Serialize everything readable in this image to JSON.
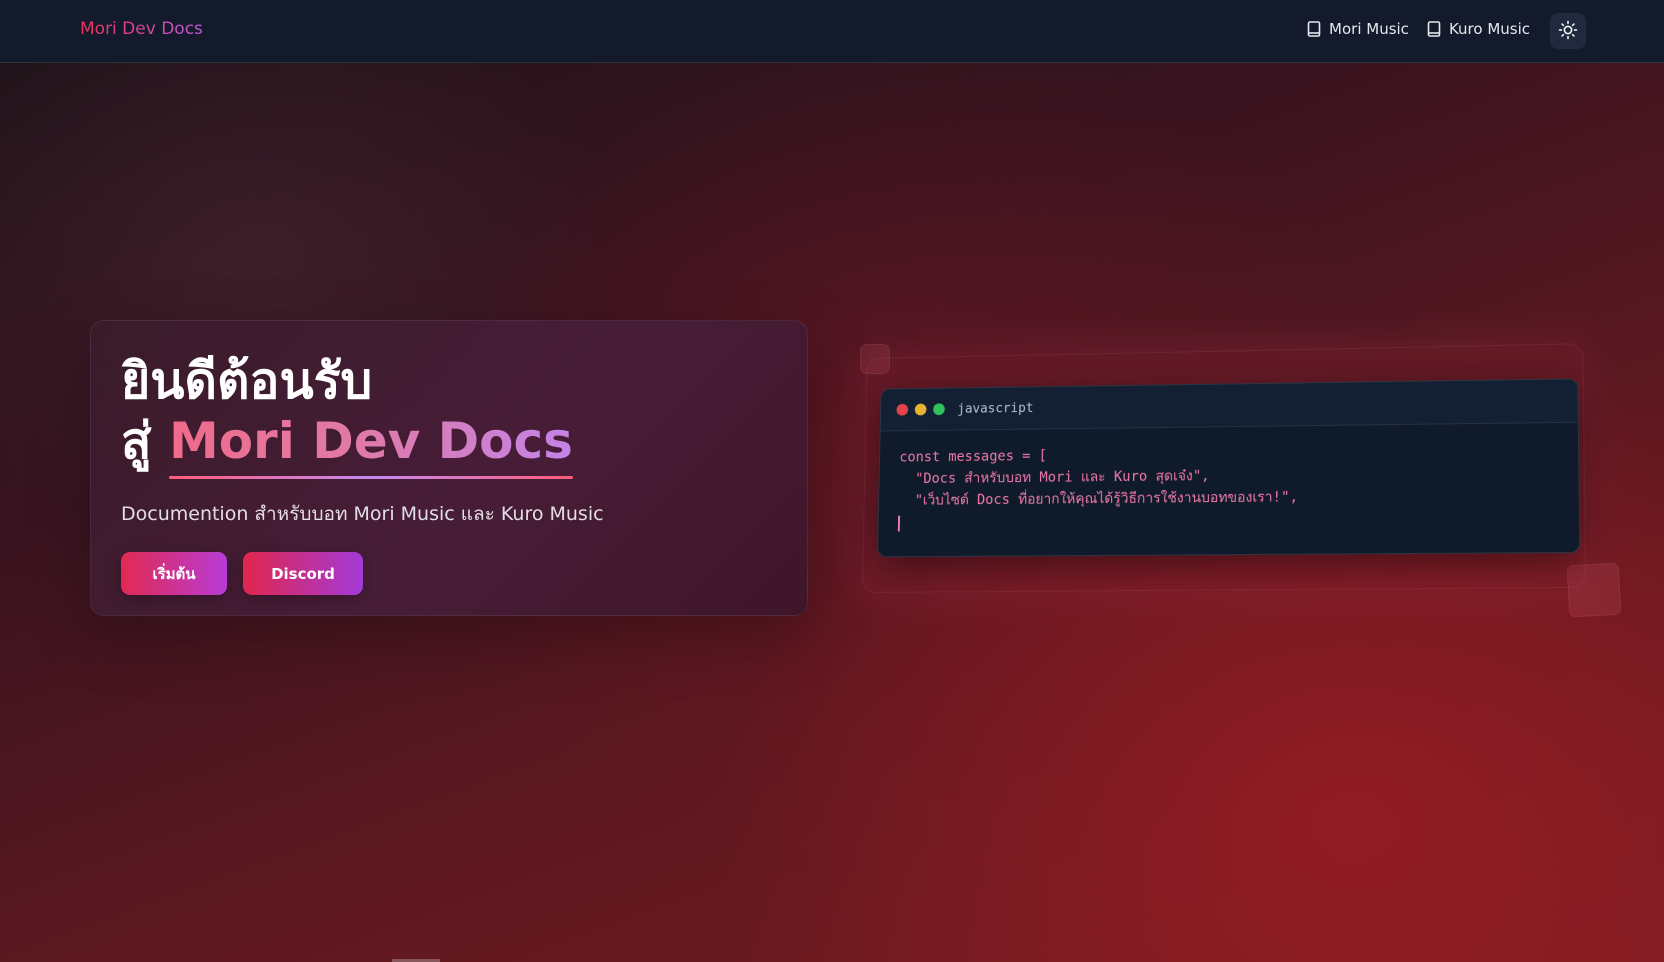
{
  "header": {
    "brand": "Mori Dev Docs",
    "nav_links": [
      {
        "label": "Mori Music",
        "icon": "book-icon"
      },
      {
        "label": "Kuro Music",
        "icon": "book-icon"
      }
    ],
    "theme_toggle_icon": "sun-icon"
  },
  "hero": {
    "title_line1": "ยินดีต้อนรับ",
    "title_prefix": "สู่",
    "title_highlight": "Mori Dev Docs",
    "subtitle": "Documention สำหรับบอท Mori Music และ Kuro Music",
    "buttons": {
      "start": "เริ่มต้น",
      "discord": "Discord"
    }
  },
  "code_window": {
    "language": "javascript",
    "lines": [
      "const messages = [",
      "  \"Docs สำหรับบอท Mori และ Kuro สุดเจ๋ง\",",
      "  \"เว็บไซต์ Docs ที่อยากให้คุณได้รู้วิธีการใช้งานบอทของเรา!\","
    ]
  },
  "colors": {
    "navbar_bg": "#121a2b",
    "brand_gradient_start": "#ef2f5a",
    "brand_gradient_end": "#c05bd8",
    "code_text": "#f07aaa",
    "button_gradient_start": "#e12a52",
    "button_gradient_end": "#b73cd6"
  }
}
